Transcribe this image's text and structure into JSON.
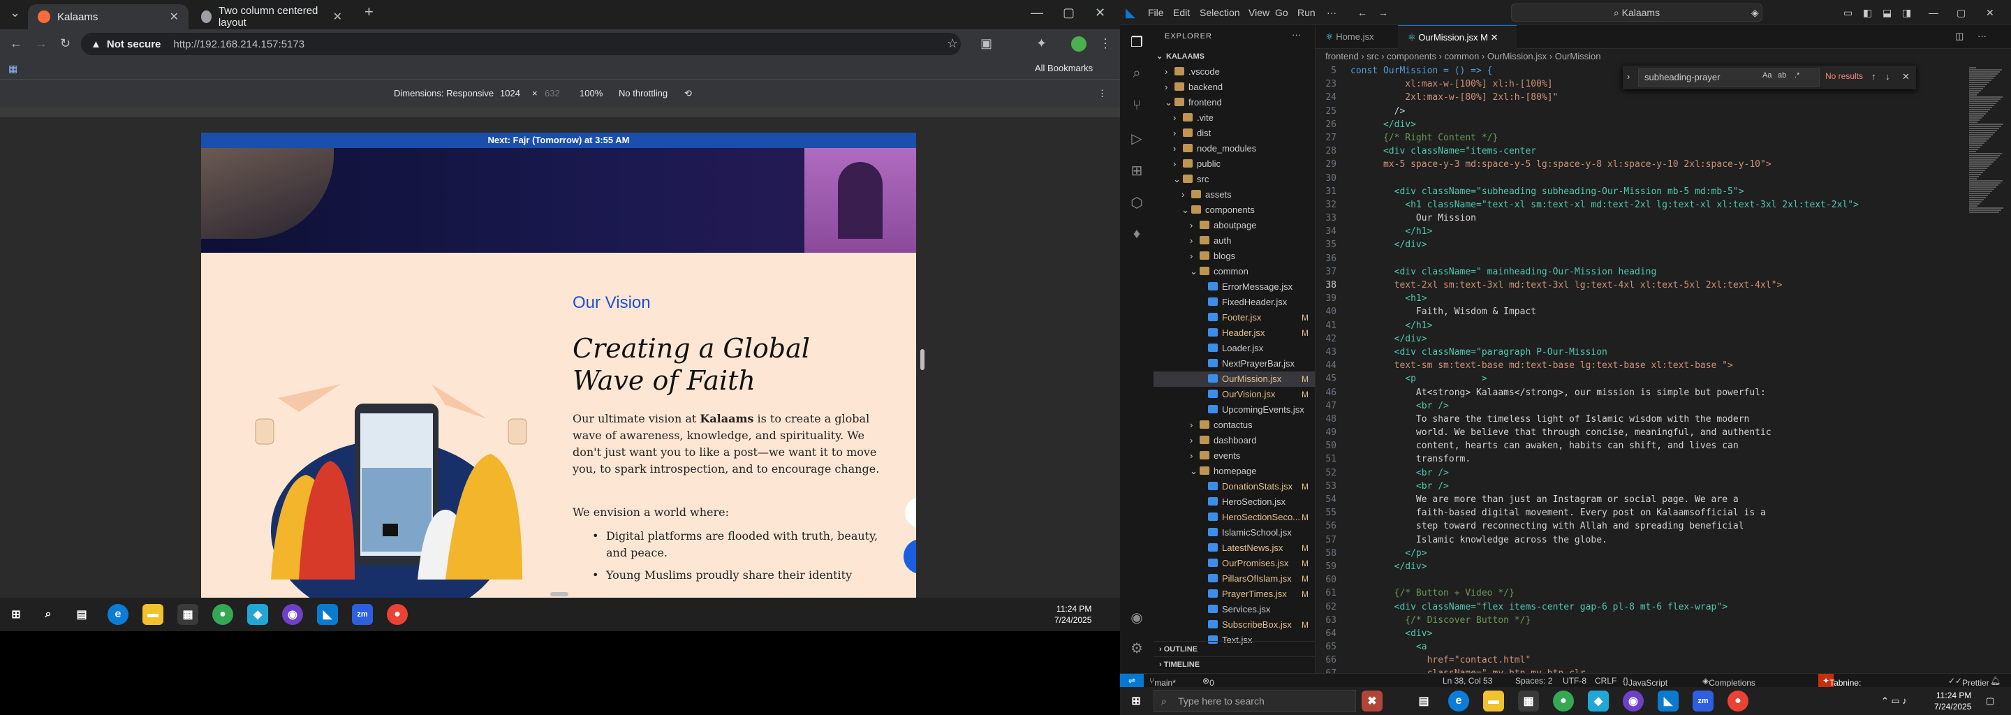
{
  "browser": {
    "tabs": [
      {
        "title": "Kalaams",
        "active": true
      },
      {
        "title": "Two column centered layout",
        "active": false
      }
    ],
    "security_label": "Not secure",
    "url": "http://192.168.214.157:5173",
    "bookmarks_label": "All Bookmarks",
    "devtools": {
      "dimensions_label": "Dimensions: Responsive",
      "width": "1024",
      "height": "632",
      "zoom": "100%",
      "throttle": "No throttling"
    }
  },
  "page": {
    "prayer_prefix": "Next: ",
    "prayer_name": "Fajr (Tomorrow)",
    "prayer_suffix": " at 3:55 AM",
    "vision_label": "Our Vision",
    "vision_title": "Creating a Global Wave of Faith",
    "para_lead": "Our ultimate vision at ",
    "para_brand": "Kalaams",
    "para_rest": " is to create a global wave of awareness, knowledge, and spirituality. We don't just want you to like a post—we want it to move you, to spark introspection, and to encourage change.",
    "envision": "We envision a world where:",
    "bullets": [
      "Digital platforms are flooded with truth, beauty, and peace.",
      "Young Muslims proudly share their identity"
    ]
  },
  "vscode": {
    "menus": [
      "File",
      "Edit",
      "Selection",
      "View",
      "Go",
      "Run",
      "···"
    ],
    "search": "Kalaams",
    "explorer_title": "EXPLORER",
    "root": "KALAAMS",
    "tree": [
      {
        "label": ".vscode",
        "type": "folder",
        "depth": 1
      },
      {
        "label": "backend",
        "type": "folder",
        "depth": 1
      },
      {
        "label": "frontend",
        "type": "folder",
        "depth": 1,
        "open": true
      },
      {
        "label": ".vite",
        "type": "folder",
        "depth": 2
      },
      {
        "label": "dist",
        "type": "folder",
        "depth": 2
      },
      {
        "label": "node_modules",
        "type": "folder",
        "depth": 2
      },
      {
        "label": "public",
        "type": "folder",
        "depth": 2
      },
      {
        "label": "src",
        "type": "folder",
        "depth": 2,
        "open": true
      },
      {
        "label": "assets",
        "type": "folder",
        "depth": 3
      },
      {
        "label": "components",
        "type": "folder",
        "depth": 3,
        "open": true
      },
      {
        "label": "aboutpage",
        "type": "folder",
        "depth": 4
      },
      {
        "label": "auth",
        "type": "folder",
        "depth": 4
      },
      {
        "label": "blogs",
        "type": "folder",
        "depth": 4
      },
      {
        "label": "common",
        "type": "folder",
        "depth": 4,
        "open": true
      },
      {
        "label": "ErrorMessage.jsx",
        "type": "file",
        "depth": 5
      },
      {
        "label": "FixedHeader.jsx",
        "type": "file",
        "depth": 5
      },
      {
        "label": "Footer.jsx",
        "type": "file",
        "depth": 5,
        "badge": "M"
      },
      {
        "label": "Header.jsx",
        "type": "file",
        "depth": 5,
        "badge": "M"
      },
      {
        "label": "Loader.jsx",
        "type": "file",
        "depth": 5
      },
      {
        "label": "NextPrayerBar.jsx",
        "type": "file",
        "depth": 5
      },
      {
        "label": "OurMission.jsx",
        "type": "file",
        "depth": 5,
        "badge": "M",
        "selected": true
      },
      {
        "label": "OurVision.jsx",
        "type": "file",
        "depth": 5,
        "badge": "M"
      },
      {
        "label": "UpcomingEvents.jsx",
        "type": "file",
        "depth": 5
      },
      {
        "label": "contactus",
        "type": "folder",
        "depth": 4
      },
      {
        "label": "dashboard",
        "type": "folder",
        "depth": 4
      },
      {
        "label": "events",
        "type": "folder",
        "depth": 4
      },
      {
        "label": "homepage",
        "type": "folder",
        "depth": 4,
        "open": true
      },
      {
        "label": "DonationStats.jsx",
        "type": "file",
        "depth": 5,
        "badge": "M"
      },
      {
        "label": "HeroSection.jsx",
        "type": "file",
        "depth": 5
      },
      {
        "label": "HeroSectionSeco...",
        "type": "file",
        "depth": 5,
        "badge": "M"
      },
      {
        "label": "IslamicSchool.jsx",
        "type": "file",
        "depth": 5
      },
      {
        "label": "LatestNews.jsx",
        "type": "file",
        "depth": 5,
        "badge": "M"
      },
      {
        "label": "OurPromises.jsx",
        "type": "file",
        "depth": 5,
        "badge": "M"
      },
      {
        "label": "PillarsOfIslam.jsx",
        "type": "file",
        "depth": 5,
        "badge": "M"
      },
      {
        "label": "PrayerTimes.jsx",
        "type": "file",
        "depth": 5,
        "badge": "M"
      },
      {
        "label": "Services.jsx",
        "type": "file",
        "depth": 5
      },
      {
        "label": "SubscribeBox.jsx",
        "type": "file",
        "depth": 5,
        "badge": "M"
      },
      {
        "label": "Text.jsx",
        "type": "file",
        "depth": 5
      }
    ],
    "outline_label": "OUTLINE",
    "timeline_label": "TIMELINE",
    "editor_tabs": [
      {
        "label": "Home.jsx",
        "active": false
      },
      {
        "label": "OurMission.jsx M",
        "active": true
      }
    ],
    "breadcrumb": "frontend › src › components › common › OurMission.jsx › OurMission",
    "find_query": "subheading-prayer",
    "find_result": "No results",
    "sticky_line": {
      "num": "5",
      "text": "const OurMission = () => {"
    },
    "code_lines": [
      {
        "num": "23",
        "text": "          xl:max-w-[100%] xl:h-[100%]"
      },
      {
        "num": "24",
        "text": "          2xl:max-w-[80%] 2xl:h-[80%]\""
      },
      {
        "num": "25",
        "text": "        />"
      },
      {
        "num": "26",
        "text": "      </div>"
      },
      {
        "num": "27",
        "text": "      {/* Right Content */}"
      },
      {
        "num": "28",
        "text": "      <div className=\"items-center"
      },
      {
        "num": "29",
        "text": "      mx-5 space-y-3 md:space-y-5 lg:space-y-8 xl:space-y-10 2xl:space-y-10\">"
      },
      {
        "num": "30",
        "text": ""
      },
      {
        "num": "31",
        "text": "        <div className=\"subheading subheading-Our-Mission mb-5 md:mb-5\">"
      },
      {
        "num": "32",
        "text": "          <h1 className=\"text-xl sm:text-xl md:text-2xl lg:text-xl xl:text-3xl 2xl:text-2xl\">"
      },
      {
        "num": "33",
        "text": "            Our Mission"
      },
      {
        "num": "34",
        "text": "          </h1>"
      },
      {
        "num": "35",
        "text": "        </div>"
      },
      {
        "num": "36",
        "text": ""
      },
      {
        "num": "37",
        "text": "        <div className=\" mainheading-Our-Mission heading"
      },
      {
        "num": "38",
        "text": "        text-2xl sm:text-3xl md:text-3xl lg:text-4xl xl:text-5xl 2xl:text-4xl\">"
      },
      {
        "num": "39",
        "text": "          <h1>"
      },
      {
        "num": "40",
        "text": "            Faith, Wisdom & Impact"
      },
      {
        "num": "41",
        "text": "          </h1>"
      },
      {
        "num": "42",
        "text": "        </div>"
      },
      {
        "num": "43",
        "text": "        <div className=\"paragraph P-Our-Mission"
      },
      {
        "num": "44",
        "text": "        text-sm sm:text-base md:text-base lg:text-base xl:text-base \">"
      },
      {
        "num": "45",
        "text": "          <p            >"
      },
      {
        "num": "46",
        "text": "            At<strong> Kalaams</strong>, our mission is simple but powerful:"
      },
      {
        "num": "47",
        "text": "            <br />"
      },
      {
        "num": "48",
        "text": "            To share the timeless light of Islamic wisdom with the modern"
      },
      {
        "num": "49",
        "text": "            world. We believe that through concise, meaningful, and authentic"
      },
      {
        "num": "50",
        "text": "            content, hearts can awaken, habits can shift, and lives can"
      },
      {
        "num": "51",
        "text": "            transform."
      },
      {
        "num": "52",
        "text": "            <br />"
      },
      {
        "num": "53",
        "text": "            <br />"
      },
      {
        "num": "54",
        "text": "            We are more than just an Instagram or social page. We are a"
      },
      {
        "num": "55",
        "text": "            faith-based digital movement. Every post on Kalaamsofficial is a"
      },
      {
        "num": "56",
        "text": "            step toward reconnecting with Allah and spreading beneficial"
      },
      {
        "num": "57",
        "text": "            Islamic knowledge across the globe."
      },
      {
        "num": "58",
        "text": "          </p>"
      },
      {
        "num": "59",
        "text": "        </div>"
      },
      {
        "num": "60",
        "text": ""
      },
      {
        "num": "61",
        "text": "        {/* Button + Video */}"
      },
      {
        "num": "62",
        "text": "        <div className=\"flex items-center gap-6 pl-8 mt-6 flex-wrap\">"
      },
      {
        "num": "63",
        "text": "          {/* Discover Button */}"
      },
      {
        "num": "64",
        "text": "          <div>"
      },
      {
        "num": "65",
        "text": "            <a"
      },
      {
        "num": "66",
        "text": "              href=\"contact.html\""
      },
      {
        "num": "67",
        "text": "              className=\" my-btn my-btn-clr"
      }
    ],
    "status": {
      "branch": "main*",
      "position": "Ln 38, Col 53",
      "spaces": "Spaces: 2",
      "encoding": "UTF-8",
      "eol": "CRLF",
      "language": "JavaScript JSX",
      "quota": "Completions quota reached",
      "tabnine": "Tabnine: Sign-in is required",
      "prettier": "Prettier",
      "problems": "0 ⚠ 0"
    }
  },
  "taskbar": {
    "left_time": "11:24 PM",
    "left_date": "7/24/2025",
    "right_time": "11:24 PM",
    "right_date": "7/24/2025",
    "search_placeholder": "Type here to search"
  },
  "colors": {
    "accent_blue": "#1b4fd8",
    "prayer_bar": "#1a4fae",
    "page_bg": "#fde7d4",
    "vscode_accent": "#0078d4",
    "tabnine_badge": "#c72e0f"
  }
}
